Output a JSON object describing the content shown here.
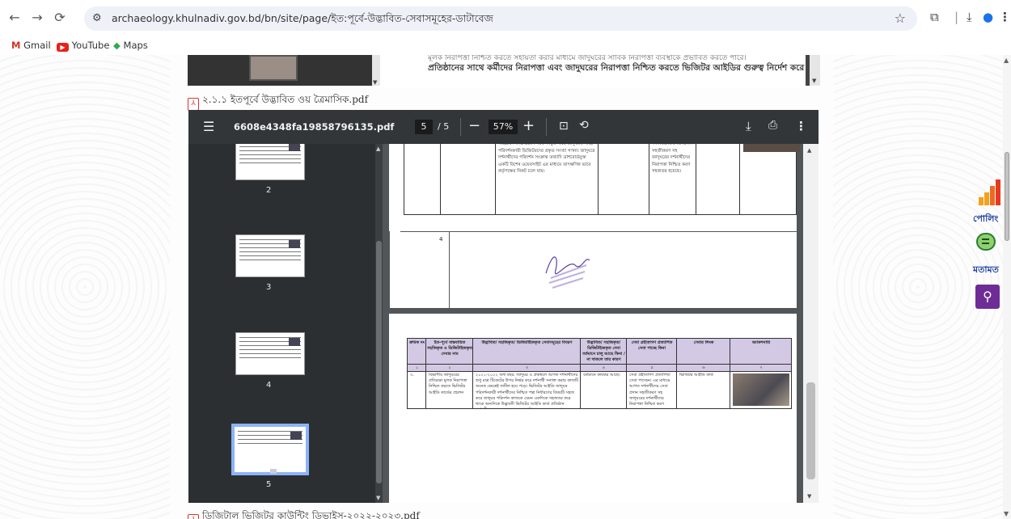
{
  "browser": {
    "url": "archaeology.khulnadiv.gov.bd/bn/site/page/ইত:পূর্বে-উদ্ভাবিত-সেবাসমূহের-ডাটাবেজ",
    "bookmarks": [
      "Gmail",
      "YouTube",
      "Maps"
    ]
  },
  "page": {
    "top_text_line1": "মূলক নিরাপত্তা নিশ্চিত করতে সহায়তা করার মাধ্যমে জাদুঘরের সার্বিক নিরাপত্তা ব্যবস্থাকে প্রভাবিত করতে পারে।",
    "top_text_line2": "প্রতিষ্ঠানের সাথে কর্মীদের নিরাপত্তা এবং জাদুঘরের নিরাপত্তা নিশ্চিত করতে ভিজিটর আইডির গুরুত্ব নির্দেশ করে।",
    "pdf_link_1": "২.১.১ ইতপূর্বে উদ্ভাবিত ওয় ত্রৈমাসিক.pdf",
    "pdf_link_2": "ডিজিটাল ভিজিটর কাউন্টিং ডিভাইস-২০২২-২০২৩.pdf"
  },
  "pdf_viewer": {
    "filename": "6608e4348fa19858796135.pdf",
    "current_page": "5",
    "total_pages": "/ 5",
    "zoom": "57%",
    "thumbnail_labels": [
      "2",
      "3",
      "4",
      "5"
    ]
  },
  "doc": {
    "page1_cells": {
      "col2": "সাইটের নির্দিষ্ট প্রবেশ পথে সংযুক্ত করে জাদুঘর / সাইট পরিদর্শনকারী ভিজিটরদের প্রকৃত সংখ্যা গণনা। জাদুঘরে দর্শনার্থীদের পরিদর্শন সংক্রান্ত তথ্যাদি ডাশবোর্ডযুক্ত একটি বিশেষ ওয়েবসাইট এর মাধ্যমে তাৎক্ষণিক ভাবে কর্তৃপক্ষের নিকট চলে যায়।",
      "col4": "দর্শনার্থীদের সেবা প্রদান সহজীকরণ সহ জাদুঘরের দর্শনার্থীদের নিরাপত্তা নিশ্চিত করণ সহজতর হয়েছে।"
    },
    "page1_row_number": "4",
    "table_headers": [
      "ক্রমিক নং",
      "ইত-পূর্বে বাস্তবায়িত সহজিকৃত ও ডিজিটাইজকৃত সেবার নাম",
      "উদ্ভাবিত/ সহজিকৃত/ ডিজিটাইজকৃত সেবাসমূহের বিবরণ",
      "উদ্ভাবিত/ সহজিকৃত/ ডিজিটাইজকৃত সেবা বর্তমানে চালু আছে কিনা / না থাকলে তার কারণ",
      "সেবা গ্রহীতাগণ প্রত্যাশিত সেবা পাচ্ছে কিনা",
      "সেবার লিংক",
      "অ্যাকশনারি"
    ],
    "table_numbers": [
      "১",
      "২",
      "৩",
      "৪",
      "৫",
      "৬",
      "৭"
    ],
    "row": {
      "serial": "৩.",
      "name": "বিভাগীয় জাদুঘরের প্রতিরক্ষা মূলক নিরাপত্তা নিশ্চিত করতে ভিজিটর আইডি কার্ডের প্রচলন",
      "description": "২০২১-২০২২ অর্থ বছর: জাদুঘর ও প্রত্নস্থলে আগত দর্শনার্থীদের শুধু মাত্র টিকেটের উপর নির্ভর করে দর্শনার্থী সনাক্ত করার কাজটি অনেক ক্ষেত্রেই জটিল হয়ে পড়ে। ভিজিটর আইডি জাদুঘর পরিদর্শনকারী দর্শনার্থীদের নিশ্চিত পন্থা নির্ধারণের বিষয়টি সহজ করে জাদুঘর পরিদর্শন কাজকে যেমন একদিকে সহজতর করে থাকে অন্যদিকে উদ্ভাবনী ভিজিটর আইডি কার্ড প্রতিষ্ঠান কর্মচারীদের সময় সাশ্রয়ের পাশাপাশি শ্রমের অপচয় রোধ করে।",
      "status": "বর্তমানে কার্যকর আছে।",
      "outcome": "সেবা গ্রহীতাগণ প্রত্যাশিত সেবা পাচ্ছেন। এর মাধ্যমে আগত দর্শনার্থীদের সেবা প্রদান সহজীকরণ সহ জাদুঘরের দর্শনার্থীদের নিরাপত্তা নিশ্চিত করণ সহজতর হয়েছে।",
      "link": "ভিজিটর আইডি কার্ড"
    }
  },
  "right_rail": {
    "poll_label": "পোলিং",
    "feedback_label": "মতামত",
    "bar_colors": [
      "#f4a21a",
      "#f4a21a",
      "#ee6a22",
      "#e8391f"
    ],
    "bar_levels": [
      0.3,
      0.5,
      0.75,
      1.0
    ]
  }
}
